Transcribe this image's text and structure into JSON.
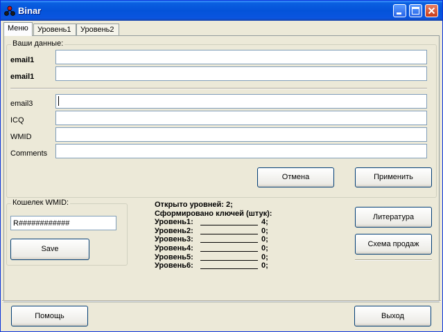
{
  "window": {
    "title": "Binar"
  },
  "tabs": [
    {
      "label": "Меню",
      "active": true
    },
    {
      "label": "Уровень1",
      "active": false
    },
    {
      "label": "Уровень2",
      "active": false
    }
  ],
  "user_data": {
    "group_label": "Ваши данные:",
    "fields": [
      {
        "label": "email1",
        "value": ""
      },
      {
        "label": "email1",
        "value": ""
      },
      {
        "label": "email3",
        "value": ""
      },
      {
        "label": "ICQ",
        "value": ""
      },
      {
        "label": "WMID",
        "value": ""
      },
      {
        "label": "Comments",
        "value": ""
      }
    ],
    "cancel_label": "Отмена",
    "apply_label": "Применить"
  },
  "wallet": {
    "group_label": "Кошелек WMID:",
    "value": "R############",
    "save_label": "Save"
  },
  "stats": {
    "opened_levels": "Открыто уровней: 2;",
    "keys_formed": "Сформировано ключей (штук):",
    "levels": [
      {
        "label": "Уровень1:",
        "value": "4;"
      },
      {
        "label": "Уровень2:",
        "value": "0;"
      },
      {
        "label": "Уровень3:",
        "value": "0;"
      },
      {
        "label": "Уровень4:",
        "value": "0;"
      },
      {
        "label": "Уровень5:",
        "value": "0;"
      },
      {
        "label": "Уровень6:",
        "value": "0;"
      }
    ]
  },
  "side_buttons": {
    "literature_label": "Литература",
    "sales_scheme_label": "Схема продаж"
  },
  "footer": {
    "help_label": "Помощь",
    "exit_label": "Выход"
  },
  "colors": {
    "titlebar": "#0453d9",
    "window_bg": "#ece9d8",
    "button_border": "#003c74",
    "field_border": "#7f9db9"
  }
}
